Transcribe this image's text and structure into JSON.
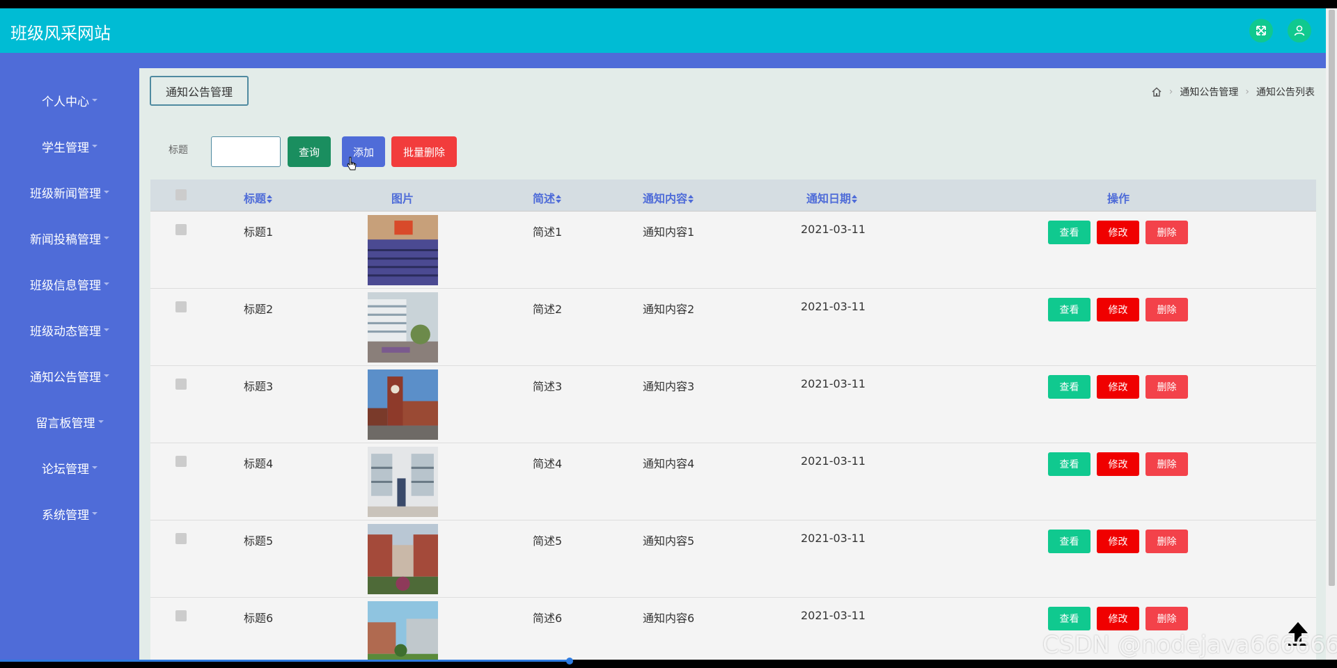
{
  "header": {
    "site_title": "班级风采网站"
  },
  "sidebar": {
    "items": [
      {
        "label": "个人中心"
      },
      {
        "label": "学生管理"
      },
      {
        "label": "班级新闻管理"
      },
      {
        "label": "新闻投稿管理"
      },
      {
        "label": "班级信息管理"
      },
      {
        "label": "班级动态管理"
      },
      {
        "label": "通知公告管理"
      },
      {
        "label": "留言板管理"
      },
      {
        "label": "论坛管理"
      },
      {
        "label": "系统管理"
      }
    ]
  },
  "page": {
    "tag": "通知公告管理",
    "breadcrumb": [
      "通知公告管理",
      "通知公告列表"
    ]
  },
  "search": {
    "label": "标题",
    "value": "",
    "query_label": "查询",
    "add_label": "添加",
    "bulk_delete_label": "批量删除"
  },
  "table": {
    "columns": [
      "标题",
      "图片",
      "简述",
      "通知内容",
      "通知日期",
      "操作"
    ],
    "rows": [
      {
        "title": "标题1",
        "summary": "简述1",
        "content": "通知内容1",
        "date": "2021-03-11",
        "image": "auditorium"
      },
      {
        "title": "标题2",
        "summary": "简述2",
        "content": "通知内容2",
        "date": "2021-03-11",
        "image": "campus-building"
      },
      {
        "title": "标题3",
        "summary": "简述3",
        "content": "通知内容3",
        "date": "2021-03-11",
        "image": "clock-tower"
      },
      {
        "title": "标题4",
        "summary": "简述4",
        "content": "通知内容4",
        "date": "2021-03-11",
        "image": "dormitory"
      },
      {
        "title": "标题5",
        "summary": "简述5",
        "content": "通知内容5",
        "date": "2021-03-11",
        "image": "brick-building"
      },
      {
        "title": "标题6",
        "summary": "简述6",
        "content": "通知内容6",
        "date": "2021-03-11",
        "image": "courtyard"
      }
    ],
    "actions": {
      "view": "查看",
      "edit": "修改",
      "delete": "删除"
    }
  },
  "watermark": "CSDN @nodejava666666",
  "colors": {
    "topbar": "#00bcd4",
    "sidebar": "#4f6cd8",
    "view": "#10c98f",
    "edit": "#f00000",
    "delete": "#f3424a"
  }
}
